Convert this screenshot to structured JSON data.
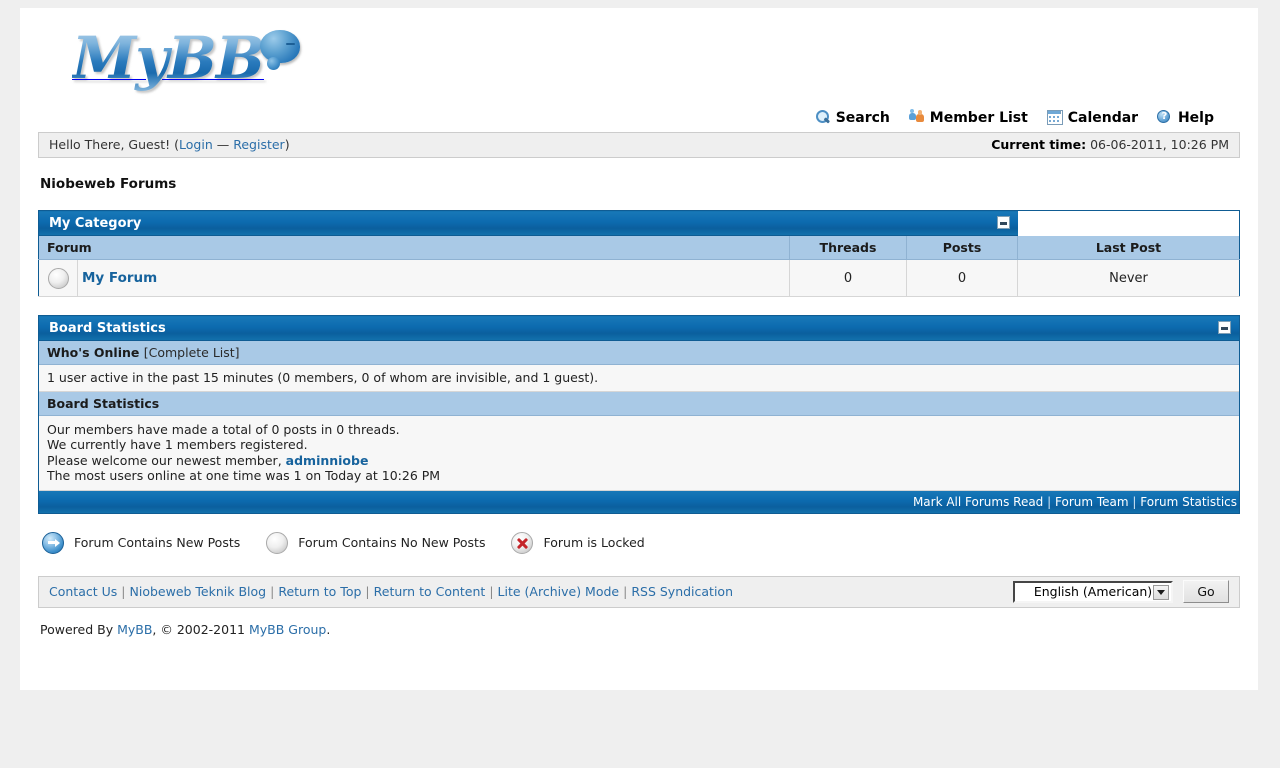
{
  "site": {
    "logo_text": "MyBB",
    "board_name": "Niobeweb Forums"
  },
  "topnav": {
    "items": [
      {
        "label": "Search",
        "icon": "search-icon"
      },
      {
        "label": "Member List",
        "icon": "members-icon"
      },
      {
        "label": "Calendar",
        "icon": "calendar-icon"
      },
      {
        "label": "Help",
        "icon": "help-icon"
      }
    ]
  },
  "welcome": {
    "greeting": "Hello There, Guest!",
    "open_paren": "(",
    "login": "Login",
    "dash": "—",
    "register": "Register",
    "close_paren": ")",
    "current_time_label": "Current time:",
    "current_time_value": "06-06-2011, 10:26 PM"
  },
  "category": {
    "title": "My Category",
    "columns": {
      "forum": "Forum",
      "threads": "Threads",
      "posts": "Posts",
      "last_post": "Last Post"
    },
    "rows": [
      {
        "icon": "forum-no-new-posts-icon",
        "name": "My Forum",
        "threads": "0",
        "posts": "0",
        "last_post": "Never"
      }
    ]
  },
  "board_statistics": {
    "title": "Board Statistics",
    "whos_online": {
      "heading": "Who's Online",
      "complete_list": "[Complete List]",
      "text": "1 user active in the past 15 minutes (0 members, 0 of whom are invisible, and 1 guest)."
    },
    "stats": {
      "heading": "Board Statistics",
      "line1": "Our members have made a total of 0 posts in 0 threads.",
      "line2": "We currently have 1 members registered.",
      "line3_prefix": "Please welcome our newest member,",
      "newest_member": "adminniobe",
      "line4": "The most users online at one time was 1 on Today at 10:26 PM"
    },
    "footer_links": [
      "Mark All Forums Read",
      "Forum Team",
      "Forum Statistics"
    ]
  },
  "legend": [
    {
      "icon": "forum-new-posts-icon",
      "label": "Forum Contains New Posts"
    },
    {
      "icon": "forum-no-new-posts-icon",
      "label": "Forum Contains No New Posts"
    },
    {
      "icon": "forum-locked-icon",
      "label": "Forum is Locked"
    }
  ],
  "footer": {
    "links": [
      "Contact Us",
      "Niobeweb Teknik Blog",
      "Return to Top",
      "Return to Content",
      "Lite (Archive) Mode",
      "RSS Syndication"
    ],
    "language_selected": "English (American)",
    "go_label": "Go",
    "powered_prefix": "Powered By",
    "powered_mybb": "MyBB",
    "powered_middle": ", © 2002-2011",
    "powered_group": "MyBB Group",
    "powered_suffix": "."
  },
  "colors": {
    "header_blue": "#0c6aae",
    "column_blue": "#a9c9e6",
    "link_blue": "#17639d",
    "page_bg": "#efefef"
  }
}
